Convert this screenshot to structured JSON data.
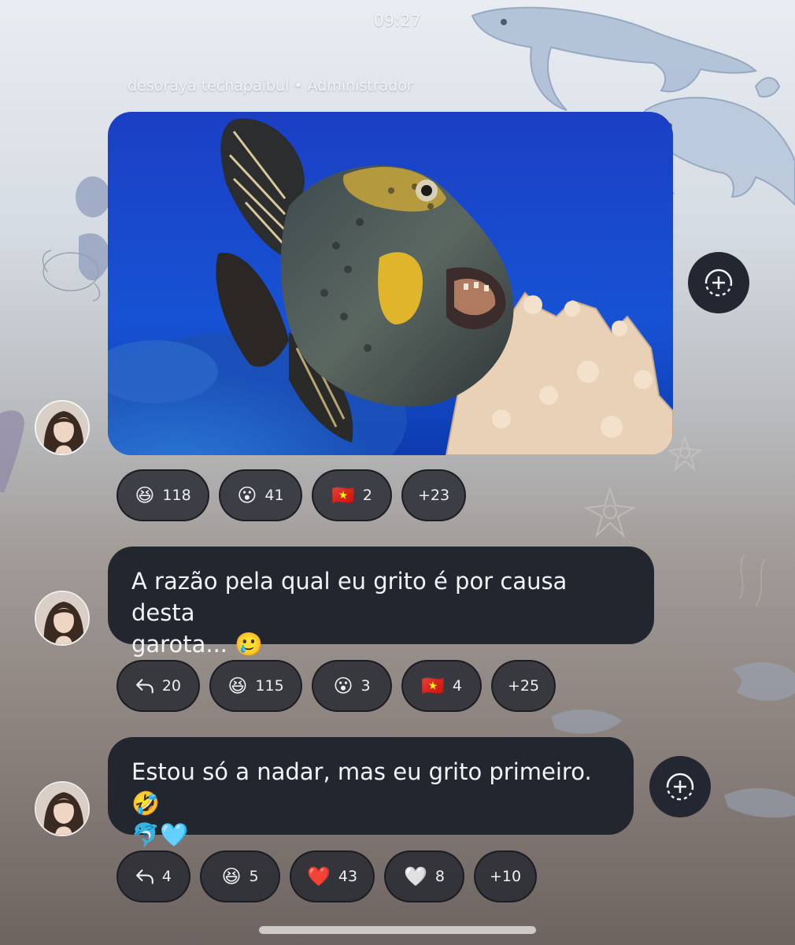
{
  "status_bar": {
    "time": "09:27"
  },
  "sender": {
    "name": "desoraya techapaibul",
    "separator": "•",
    "role": "Administrador"
  },
  "messages": [
    {
      "type": "image",
      "image_description_icon": "fish-photo",
      "reactions": [
        {
          "icon": "laughing-emoji",
          "emoji": "😆",
          "count": "118"
        },
        {
          "icon": "surprised-emoji",
          "emoji": "😮",
          "count": "41"
        },
        {
          "icon": "vietnam-flag-emoji",
          "emoji": "🇻🇳",
          "count": "2"
        },
        {
          "label": "+23"
        }
      ]
    },
    {
      "type": "text",
      "text_line1": "A razão pela qual eu grito é por causa desta",
      "text_line2": "garota... 🥲",
      "reactions": [
        {
          "icon": "reply-icon",
          "count": "20"
        },
        {
          "icon": "laughing-emoji",
          "emoji": "😆",
          "count": "115"
        },
        {
          "icon": "surprised-emoji",
          "emoji": "😮",
          "count": "3"
        },
        {
          "icon": "vietnam-flag-emoji",
          "emoji": "🇻🇳",
          "count": "4"
        },
        {
          "label": "+25"
        }
      ]
    },
    {
      "type": "text",
      "text_line1": "Estou só a nadar, mas eu grito primeiro. 🤣",
      "text_line2": "🐬🩵",
      "reactions": [
        {
          "icon": "reply-icon",
          "count": "4"
        },
        {
          "icon": "laughing-emoji",
          "emoji": "😆",
          "count": "5"
        },
        {
          "icon": "red-heart-emoji",
          "emoji": "❤️",
          "count": "43"
        },
        {
          "icon": "white-heart-emoji",
          "emoji": "🤍",
          "count": "8"
        },
        {
          "label": "+10"
        }
      ]
    }
  ],
  "colors": {
    "bubble": "#22262f",
    "chip": "#242730",
    "text": "#f2f4f7"
  }
}
